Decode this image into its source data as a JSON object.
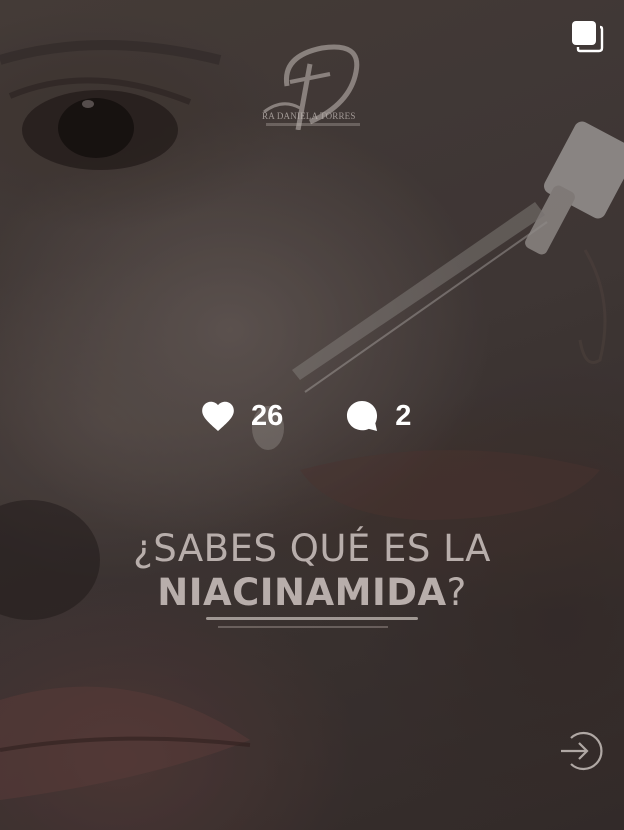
{
  "post": {
    "logo_text": "RA DANIELA TORRES",
    "stats": {
      "likes": "26",
      "comments": "2"
    },
    "headline": {
      "line1": "¿SABES QUÉ ES LA",
      "line2_bold": "NIACINAMIDA",
      "line2_suffix": "?"
    }
  },
  "icons": {
    "carousel": "multiple-images-icon",
    "like": "heart-icon",
    "comment": "comment-bubble-icon",
    "enter": "arrow-enter-icon"
  },
  "colors": {
    "overlay_text": "#ffffff",
    "headline_text": "#b8aeab"
  }
}
